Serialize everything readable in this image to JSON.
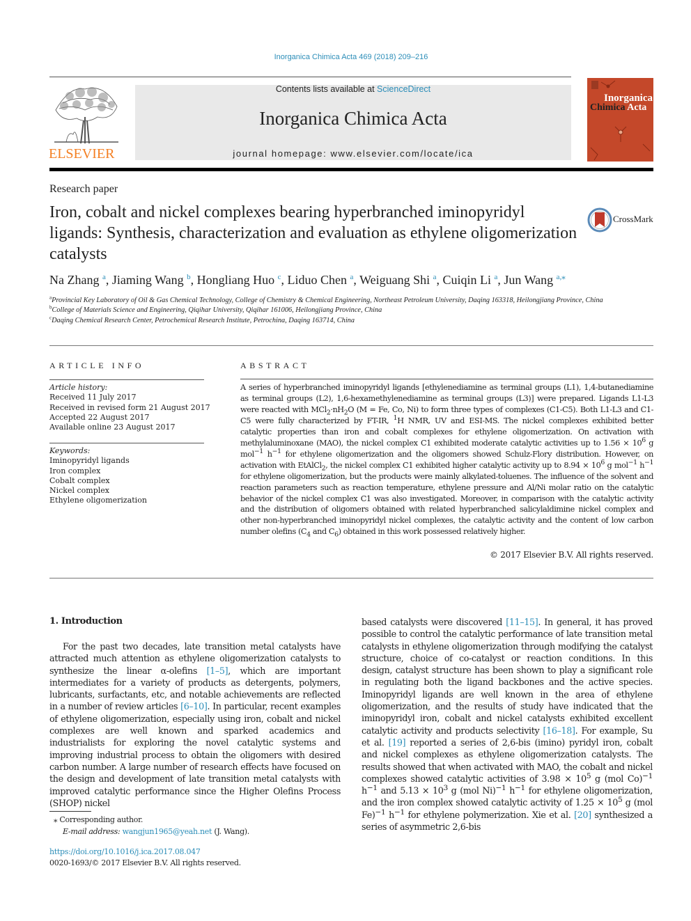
{
  "header": {
    "journal_ref": "Inorganica Chimica Acta 469 (2018) 209–216",
    "contents_prefix": "Contents lists available at ",
    "contents_link": "ScienceDirect",
    "journal_title": "Inorganica Chimica Acta",
    "homepage_prefix": "journal homepage: ",
    "homepage_url": "www.elsevier.com/locate/ica",
    "publisher": "ELSEVIER",
    "cover_title_line1": "Inorganica",
    "cover_title_line2a": "Chimica",
    "cover_title_line2b": "Acta",
    "colors": {
      "link": "#2b8db8",
      "elsevier_orange": "#f47f22",
      "cover_red": "#c4482a"
    }
  },
  "article": {
    "type": "Research paper",
    "title": "Iron, cobalt and nickel complexes bearing hyperbranched iminopyridyl ligands: Synthesis, characterization and evaluation as ethylene oligomerization catalysts",
    "crossmark_label": "CrossMark",
    "authors": [
      {
        "name": "Na Zhang",
        "aff": "a"
      },
      {
        "name": "Jiaming Wang",
        "aff": "b"
      },
      {
        "name": "Hongliang Huo",
        "aff": "c"
      },
      {
        "name": "Liduo Chen",
        "aff": "a"
      },
      {
        "name": "Weiguang Shi",
        "aff": "a"
      },
      {
        "name": "Cuiqin Li",
        "aff": "a"
      },
      {
        "name": "Jun Wang",
        "aff": "a,⁎"
      }
    ],
    "affiliations": [
      {
        "key": "a",
        "text": "Provincial Key Laboratory of Oil & Gas Chemical Technology, College of Chemistry & Chemical Engineering, Northeast Petroleum University, Daqing 163318, Heilongjiang Province, China"
      },
      {
        "key": "b",
        "text": "College of Materials Science and Engineering, Qiqihar University, Qiqihar 161006, Heilongjiang Province, China"
      },
      {
        "key": "c",
        "text": "Daqing Chemical Research Center, Petrochemical Research Institute, Petrochina, Daqing 163714, China"
      }
    ]
  },
  "article_info": {
    "heading": "ARTICLE INFO",
    "history_label": "Article history:",
    "history": [
      "Received 11 July 2017",
      "Received in revised form 21 August 2017",
      "Accepted 22 August 2017",
      "Available online 23 August 2017"
    ],
    "keywords_label": "Keywords:",
    "keywords": [
      "Iminopyridyl ligands",
      "Iron complex",
      "Cobalt complex",
      "Nickel complex",
      "Ethylene oligomerization"
    ]
  },
  "abstract": {
    "heading": "ABSTRACT",
    "seg1": "A series of hyperbranched iminopyridyl ligands [ethylenediamine as terminal groups (L1), 1,4-butanediamine as terminal groups (L2), 1,6-hexamethylenediamine as terminal groups (L3)] were prepared. Ligands L1-L3 were reacted with MCl",
    "sub1": "2",
    "seg2": "·nH",
    "sub2": "2",
    "seg3": "O (M = Fe, Co, Ni) to form three types of complexes (C1-C5). Both L1-L3 and C1-C5 were fully characterized by FT-IR, ",
    "sup1": "1",
    "seg4": "H NMR, UV and ESI-MS. The nickel complexes exhibited better catalytic properties than iron and cobalt complexes for ethylene oligomerization. On activation with methylaluminoxane (MAO), the nickel complex C1 exhibited moderate catalytic activities up to 1.56 × 10",
    "sup2": "6",
    "seg5": " g mol",
    "sup3": "−1",
    "seg6": " h",
    "sup4": "−1",
    "seg7": " for ethylene oligomerization and the oligomers showed Schulz-Flory distribution. However, on activation with EtAlCl",
    "sub3": "2",
    "seg8": ", the nickel complex C1 exhibited higher catalytic activity up to 8.94 × 10",
    "sup5": "6",
    "seg9": " g mol",
    "sup6": "−1",
    "seg10": " h",
    "sup7": "−1",
    "seg11": " for ethylene oligomerization, but the products were mainly alkylated-toluenes. The influence of the solvent and reaction parameters such as reaction temperature, ethylene pressure and Al/Ni molar ratio on the catalytic behavior of the nickel complex C1 was also investigated. Moreover, in comparison with the catalytic activity and the distribution of oligomers obtained with related hyperbranched salicylaldimine nickel complex and other non-hyperbranched iminopyridyl nickel complexes, the catalytic activity and the content of low carbon number olefins (C",
    "sub4": "4",
    "seg12": " and C",
    "sub5": "6",
    "seg13": ") obtained in this work possessed relatively higher.",
    "copyright": "© 2017 Elsevier B.V. All rights reserved."
  },
  "body": {
    "section_title": "1. Introduction",
    "left": {
      "t1": "For the past two decades, late transition metal catalysts have attracted much attention as ethylene oligomerization catalysts to synthesize the linear α-olefins ",
      "r1": "[1–5]",
      "t2": ", which are important intermediates for a variety of products as detergents, polymers, lubricants, surfactants, etc, and notable achievements are reflected in a number of review articles ",
      "r2": "[6–10]",
      "t3": ". In particular, recent examples of ethylene oligomerization, especially using iron, cobalt and nickel complexes are well known and sparked academics and industrialists for exploring the novel catalytic systems and improving industrial process to obtain the oligomers with desired carbon number. A large number of research effects have focused on the design and development of late transition metal catalysts with improved catalytic performance since the Higher Olefins Process (SHOP) nickel"
    },
    "right": {
      "t1": "based catalysts were discovered ",
      "r1": "[11–15]",
      "t2": ". In general, it has proved possible to control the catalytic performance of late transition metal catalysts in ethylene oligomerization through modifying the catalyst structure, choice of co-catalyst or reaction conditions. In this design, catalyst structure has been shown to play a significant role in regulating both the ligand backbones and the active species. Iminopyridyl ligands are well known in the area of ethylene oligomerization, and the results of study have indicated that the iminopyridyl iron, cobalt and nickel catalysts exhibited excellent catalytic activity and products selectivity ",
      "r2": "[16–18]",
      "t3": ". For example, Su et al. ",
      "r3": "[19]",
      "t4": " reported a series of 2,6-bis (imino) pyridyl iron, cobalt and nickel complexes as ethylene oligomerization catalysts. The results showed that when activated with MAO, the cobalt and nickel complexes showed catalytic activities of 3.98 × 10",
      "s1": "5",
      "t5": " g (mol Co)",
      "s2": "−1",
      "t6": " h",
      "s3": "−1",
      "t7": " and 5.13 × 10",
      "s4": "3",
      "t8": " g (mol Ni)",
      "s5": "−1",
      "t9": " h",
      "s6": "−1",
      "t10": " for ethylene oligomerization, and the iron complex showed catalytic activity of 1.25 × 10",
      "s7": "5",
      "t11": " g (mol Fe)",
      "s8": "−1",
      "t12": " h",
      "s9": "−1",
      "t13": " for ethylene polymerization. Xie et al. ",
      "r4": "[20]",
      "t14": " synthesized a series of asymmetric 2,6-bis"
    }
  },
  "footer": {
    "corresponding_mark": "⁎",
    "corresponding_text": " Corresponding author.",
    "email_label": "E-mail address: ",
    "email": "wangjun1965@yeah.net",
    "email_suffix": " (J. Wang).",
    "doi": "https://doi.org/10.1016/j.ica.2017.08.047",
    "issn_line": "0020-1693/© 2017 Elsevier B.V. All rights reserved."
  }
}
